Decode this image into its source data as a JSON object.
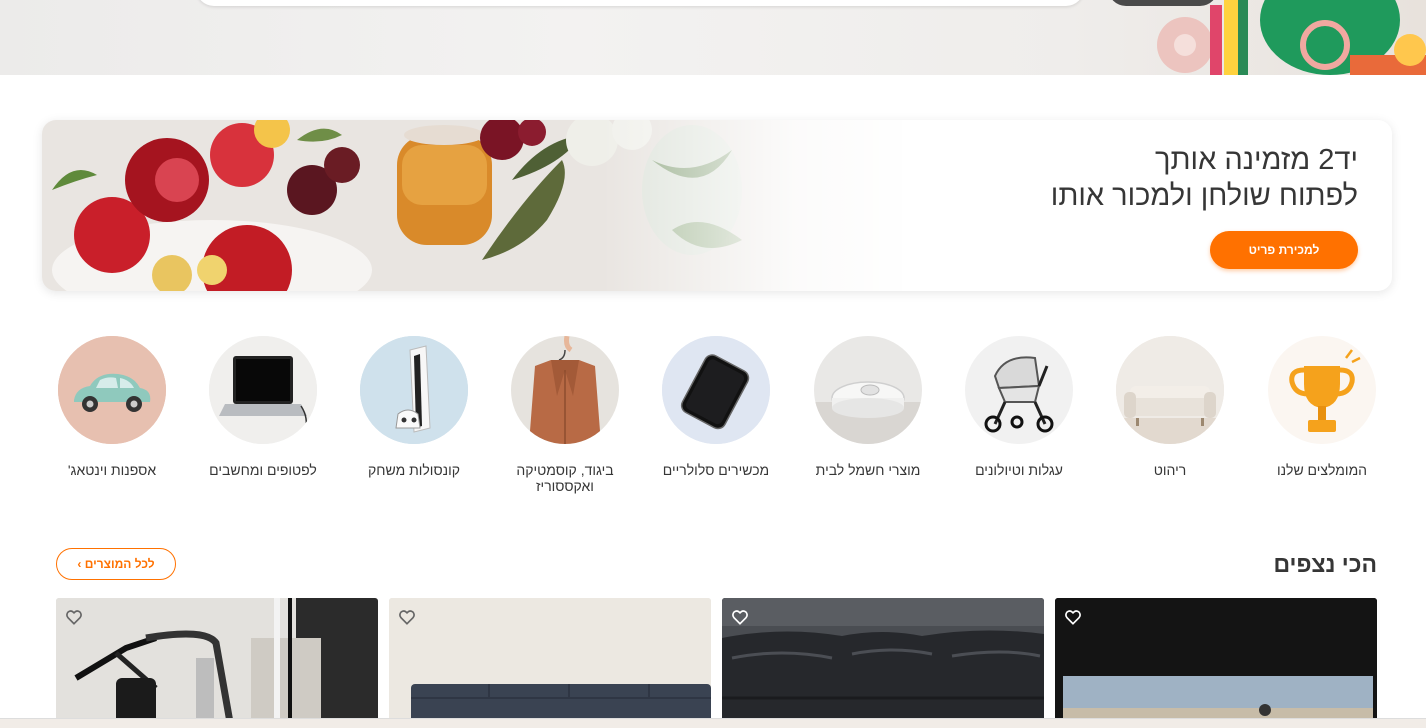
{
  "banner": {
    "title_line1": "יד2 מזמינה אותך",
    "title_line2": "לפתוח שולחן ולמכור אותו",
    "button_label": "למכירת פריט"
  },
  "categories": [
    {
      "label": "המומלצים שלנו",
      "icon": "trophy-icon"
    },
    {
      "label": "ריהוט",
      "icon": "sofa-icon"
    },
    {
      "label": "עגלות וטיולונים",
      "icon": "stroller-icon"
    },
    {
      "label": "מוצרי חשמל לבית",
      "icon": "robot-vacuum-icon"
    },
    {
      "label": "מכשירים סלולריים",
      "icon": "smartphone-icon"
    },
    {
      "label": "ביגוד, קוסמטיקה ואקססוריז",
      "icon": "jacket-icon"
    },
    {
      "label": "קונסולות משחק",
      "icon": "game-console-icon"
    },
    {
      "label": "לפטופים ומחשבים",
      "icon": "laptop-icon"
    },
    {
      "label": "אספנות וינטאג'",
      "icon": "vintage-car-icon"
    }
  ],
  "most_viewed": {
    "title": "הכי נצפים",
    "all_products_label": "לכל המוצרים ›",
    "cards": [
      {
        "image": "landscape-photo",
        "favorite_icon": "heart-icon"
      },
      {
        "image": "leather-sofa-photo",
        "favorite_icon": "heart-icon"
      },
      {
        "image": "gray-sofa-photo",
        "favorite_icon": "heart-icon"
      },
      {
        "image": "treadmill-photo",
        "favorite_icon": "heart-icon"
      }
    ]
  },
  "colors": {
    "accent": "#ff7100",
    "text": "#363636"
  }
}
